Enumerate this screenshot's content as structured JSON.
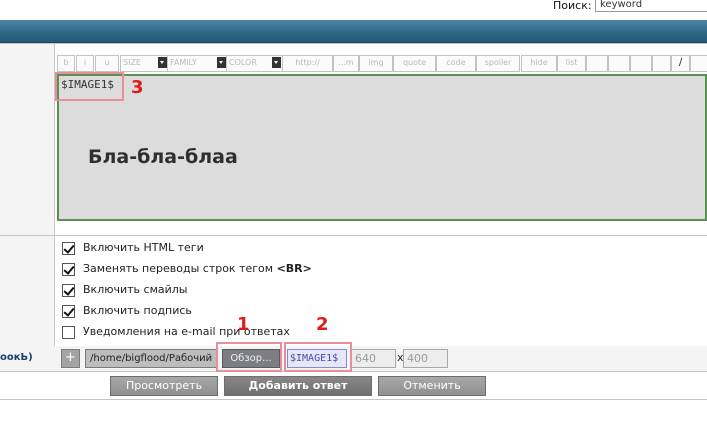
{
  "search": {
    "label": "Поиск:",
    "value": "keyword"
  },
  "toolbar": {
    "buttons": [
      "b",
      "i",
      "u"
    ],
    "selects": [
      "SIZE",
      "FAMILY",
      "COLOR"
    ],
    "tags": [
      "http://",
      "...m",
      "img",
      "quote",
      "code",
      "spoiler",
      "hide",
      "list"
    ],
    "extra": [
      "/"
    ]
  },
  "editor": {
    "tag": "$IMAGE1$",
    "text": "Бла-бла-блаа"
  },
  "options": [
    {
      "label": "Включить HTML теги",
      "checked": true
    },
    {
      "label": "Заменять переводы строк тегом",
      "bold_suffix": "<BR>",
      "checked": true
    },
    {
      "label": "Включить смайлы",
      "checked": true
    },
    {
      "label": "Включить подпись",
      "checked": true
    },
    {
      "label": "Уведомления на e-mail при ответах",
      "checked": false
    }
  ],
  "upload": {
    "left_label": "оокЬ)",
    "add_label": "+",
    "path": "/home/bigflood/Рабочий стол/",
    "browse_label": "Обзор...",
    "tag_value": "$IMAGE1$",
    "width_placeholder": "640",
    "separator": "x",
    "height_placeholder": "400"
  },
  "buttons": {
    "preview": "Просмотреть",
    "submit": "Добавить ответ",
    "cancel": "Отменить"
  },
  "callouts": [
    "1",
    "2",
    "3"
  ],
  "colors": {
    "header": "#2f6787",
    "callout": "#dd1c1c",
    "editor_border": "#5b8f55"
  }
}
